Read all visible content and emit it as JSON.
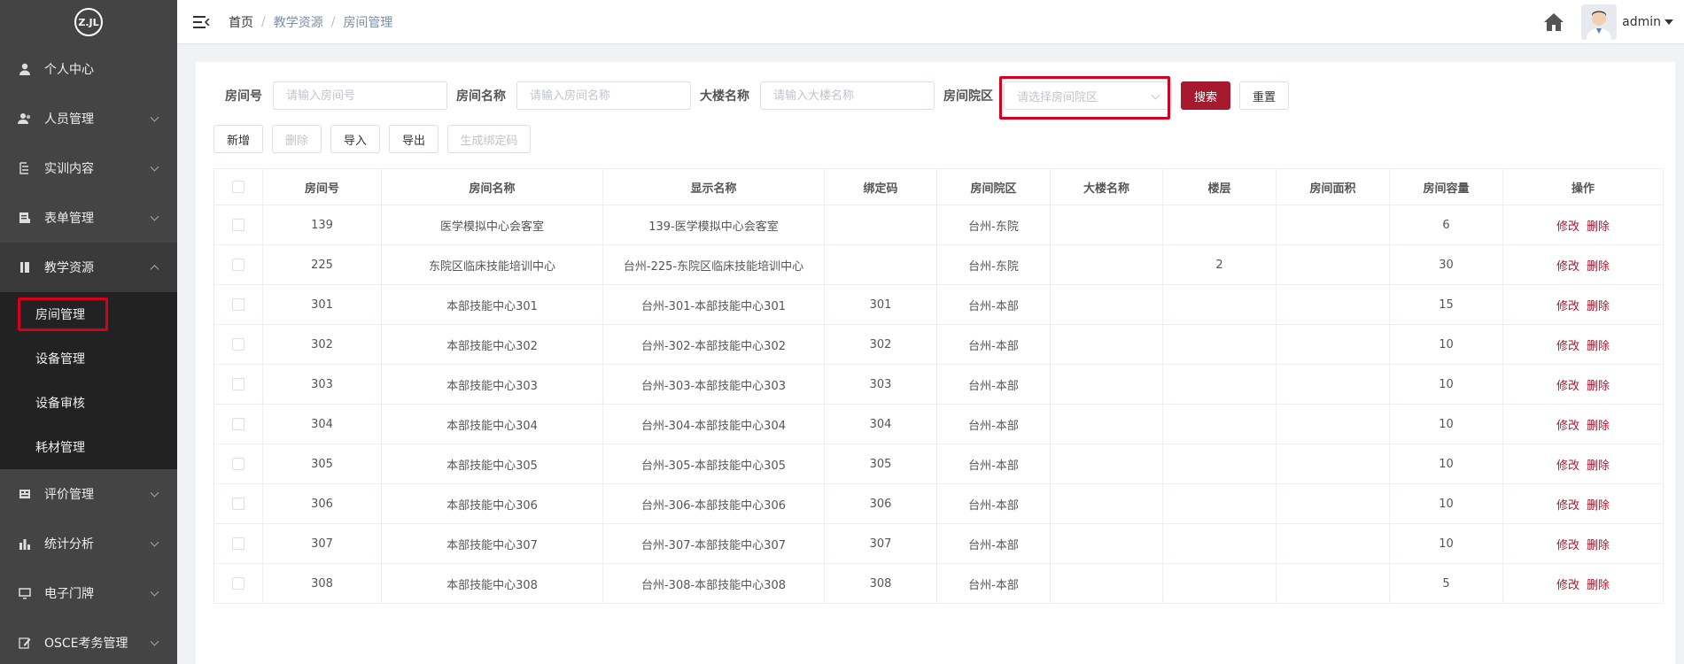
{
  "sidebar": {
    "logo_text": "Z.JL",
    "items": [
      {
        "label": "个人中心",
        "icon": "user-icon",
        "chevron": false
      },
      {
        "label": "人员管理",
        "icon": "users-icon",
        "chevron": true
      },
      {
        "label": "实训内容",
        "icon": "list-icon",
        "chevron": true
      },
      {
        "label": "表单管理",
        "icon": "form-icon",
        "chevron": true
      },
      {
        "label": "教学资源",
        "icon": "book-icon",
        "chevron": true,
        "open": true
      }
    ],
    "submenu": [
      "房间管理",
      "设备管理",
      "设备审核",
      "耗材管理"
    ],
    "items_after": [
      {
        "label": "评价管理",
        "icon": "evaluation-icon",
        "chevron": true
      },
      {
        "label": "统计分析",
        "icon": "bar-chart-icon",
        "chevron": true
      },
      {
        "label": "电子门牌",
        "icon": "monitor-icon",
        "chevron": true
      },
      {
        "label": "OSCE考务管理",
        "icon": "edit-icon",
        "chevron": true
      }
    ]
  },
  "header": {
    "breadcrumb": [
      "首页",
      "教学资源",
      "房间管理"
    ],
    "username": "admin"
  },
  "search": {
    "room_no_label": "房间号",
    "room_no_placeholder": "请输入房间号",
    "room_name_label": "房间名称",
    "room_name_placeholder": "请输入房间名称",
    "building_label": "大楼名称",
    "building_placeholder": "请输入大楼名称",
    "campus_label": "房间院区",
    "campus_placeholder": "请选择房间院区",
    "search_button": "搜索",
    "reset_button": "重置"
  },
  "actions": {
    "add": "新增",
    "delete": "删除",
    "import": "导入",
    "export": "导出",
    "gen_code": "生成绑定码"
  },
  "table": {
    "columns": [
      "房间号",
      "房间名称",
      "显示名称",
      "绑定码",
      "房间院区",
      "大楼名称",
      "楼层",
      "房间面积",
      "房间容量",
      "操作"
    ],
    "edit_label": "修改",
    "delete_label": "删除",
    "rows": [
      [
        "139",
        "医学模拟中心会客室",
        "139-医学模拟中心会客室",
        "",
        "台州-东院",
        "",
        "",
        "",
        "6"
      ],
      [
        "225",
        "东院区临床技能培训中心",
        "台州-225-东院区临床技能培训中心",
        "",
        "台州-东院",
        "",
        "2",
        "",
        "30"
      ],
      [
        "301",
        "本部技能中心301",
        "台州-301-本部技能中心301",
        "301",
        "台州-本部",
        "",
        "",
        "",
        "15"
      ],
      [
        "302",
        "本部技能中心302",
        "台州-302-本部技能中心302",
        "302",
        "台州-本部",
        "",
        "",
        "",
        "10"
      ],
      [
        "303",
        "本部技能中心303",
        "台州-303-本部技能中心303",
        "303",
        "台州-本部",
        "",
        "",
        "",
        "10"
      ],
      [
        "304",
        "本部技能中心304",
        "台州-304-本部技能中心304",
        "304",
        "台州-本部",
        "",
        "",
        "",
        "10"
      ],
      [
        "305",
        "本部技能中心305",
        "台州-305-本部技能中心305",
        "305",
        "台州-本部",
        "",
        "",
        "",
        "10"
      ],
      [
        "306",
        "本部技能中心306",
        "台州-306-本部技能中心306",
        "306",
        "台州-本部",
        "",
        "",
        "",
        "10"
      ],
      [
        "307",
        "本部技能中心307",
        "台州-307-本部技能中心307",
        "307",
        "台州-本部",
        "",
        "",
        "",
        "10"
      ],
      [
        "308",
        "本部技能中心308",
        "台州-308-本部技能中心308",
        "308",
        "台州-本部",
        "",
        "",
        "",
        "5"
      ]
    ]
  },
  "colors": {
    "sidebar_bg": "#444444",
    "submenu_bg": "#222222",
    "primary": "#a6192e",
    "highlight": "#d6001c"
  }
}
